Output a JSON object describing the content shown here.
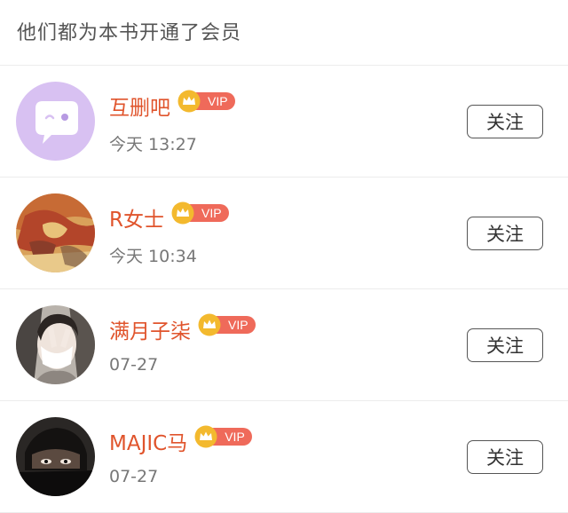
{
  "header": {
    "title": "他们都为本书开通了会员"
  },
  "members": [
    {
      "name": "互删吧",
      "time": "今天 13:27",
      "badge": "VIP",
      "follow_label": "关注"
    },
    {
      "name": "R女士",
      "time": "今天 10:34",
      "badge": "VIP",
      "follow_label": "关注"
    },
    {
      "name": "满月子柒",
      "time": "07-27",
      "badge": "VIP",
      "follow_label": "关注"
    },
    {
      "name": "MAJIC马",
      "time": "07-27",
      "badge": "VIP",
      "follow_label": "关注"
    }
  ],
  "colors": {
    "name": "#e0542c",
    "vip_pill": "#ef6a5a",
    "crown": "#f3b92e",
    "avatar_default": "#d8c1f2"
  }
}
